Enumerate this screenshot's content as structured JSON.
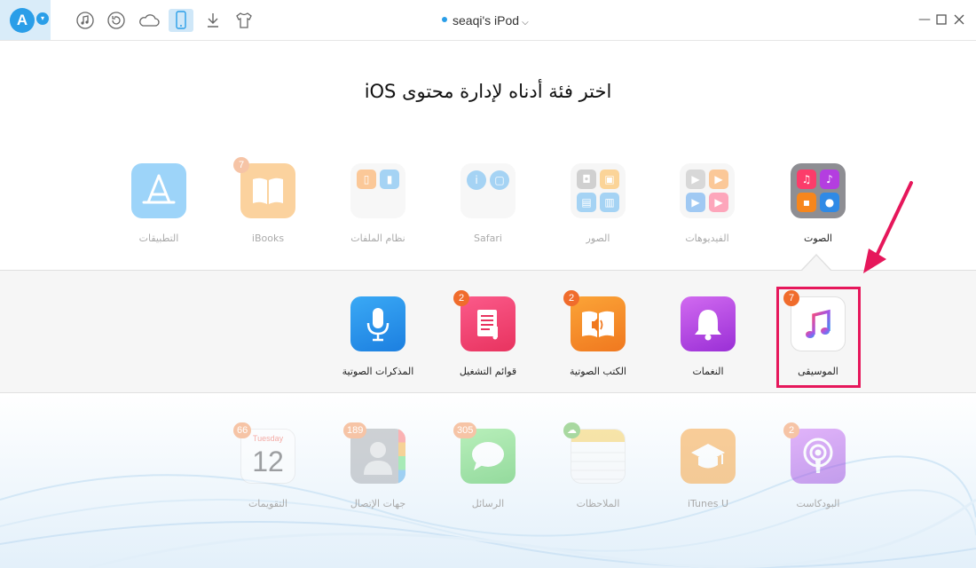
{
  "toolbar": {
    "logo": "A",
    "icons": [
      "music-icon",
      "restore-icon",
      "cloud-icon",
      "phone-icon",
      "download-icon",
      "tshirt-icon"
    ],
    "device_name": "seaqi's iPod",
    "window_controls": [
      "minimize-icon",
      "maximize-icon",
      "close-icon"
    ]
  },
  "heading": "اختر فئة أدناه لإدارة محتوى iOS",
  "categories": [
    {
      "label": "الصوت",
      "icon": "audio-folder-icon",
      "active": true
    },
    {
      "label": "الفيديوهات",
      "icon": "videos-folder-icon"
    },
    {
      "label": "الصور",
      "icon": "photos-folder-icon"
    },
    {
      "label": "Safari",
      "icon": "safari-folder-icon"
    },
    {
      "label": "نظام الملفات",
      "icon": "filesystem-folder-icon"
    },
    {
      "label": "iBooks",
      "icon": "ibooks-icon",
      "badge": "7"
    },
    {
      "label": "التطبيقات",
      "icon": "appstore-icon"
    }
  ],
  "audio_sub": [
    {
      "label": "الموسيقى",
      "icon": "music-note-icon",
      "badge": "7",
      "highlighted": true
    },
    {
      "label": "النغمات",
      "icon": "bell-icon"
    },
    {
      "label": "الكتب الصوتية",
      "icon": "audiobook-icon",
      "badge": "2"
    },
    {
      "label": "قوائم التشغيل",
      "icon": "playlist-icon",
      "badge": "2"
    },
    {
      "label": "المذكرات الصوتية",
      "icon": "microphone-icon"
    }
  ],
  "more": [
    {
      "label": "البودكاست",
      "icon": "podcast-icon",
      "badge": "2"
    },
    {
      "label": "iTunes U",
      "icon": "graduation-cap-icon"
    },
    {
      "label": "الملاحظات",
      "icon": "notes-icon"
    },
    {
      "label": "الرسائل",
      "icon": "messages-icon",
      "badge": "305"
    },
    {
      "label": "جهات الإتصال",
      "icon": "contacts-icon",
      "badge": "189"
    },
    {
      "label": "التقويمات",
      "icon": "calendar-icon",
      "badge": "66",
      "calendar_day": "Tuesday",
      "calendar_date": "12"
    }
  ],
  "colors": {
    "accent": "#2a9ee8",
    "highlight": "#e6175b",
    "badge": "#f06c2c"
  }
}
